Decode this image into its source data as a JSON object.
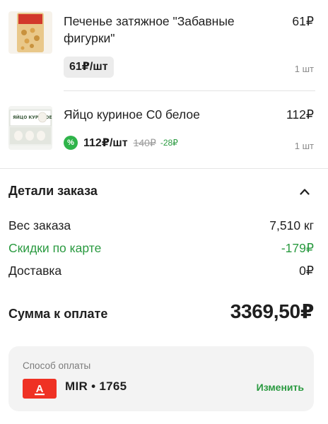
{
  "items": [
    {
      "name": "Печенье затяжное \"Забавные фигурки\"",
      "price": "61₽",
      "unit_price": "61₽/шт",
      "quantity": "1 шт",
      "thumb_icon": "cookie-pack-icon"
    },
    {
      "name": "Яйцо куриное С0 белое",
      "price": "112₽",
      "promo_badge": "%",
      "unit_price": "112₽/шт",
      "old_price": "140₽",
      "discount": "-28₽",
      "quantity": "1 шт",
      "thumb_icon": "egg-carton-icon",
      "thumb_text": "ЯЙЦО КУРИНОЕ"
    }
  ],
  "order_details": {
    "title": "Детали заказа",
    "rows": [
      {
        "label": "Вес заказа",
        "value": "7,510 кг"
      },
      {
        "label": "Скидки по карте",
        "value": "-179₽"
      },
      {
        "label": "Доставка",
        "value": "0₽"
      }
    ],
    "total_label": "Сумма к оплате",
    "total_value": "3369,50₽"
  },
  "payment": {
    "caption": "Способ оплаты",
    "bank_logo_letter": "А",
    "card": "MIR • 1765",
    "change_label": "Изменить"
  },
  "colors": {
    "accent_green": "#2a9a40",
    "bank_red": "#ef3124",
    "chip_bg": "#ececec",
    "card_bg": "#f3f3f3"
  }
}
